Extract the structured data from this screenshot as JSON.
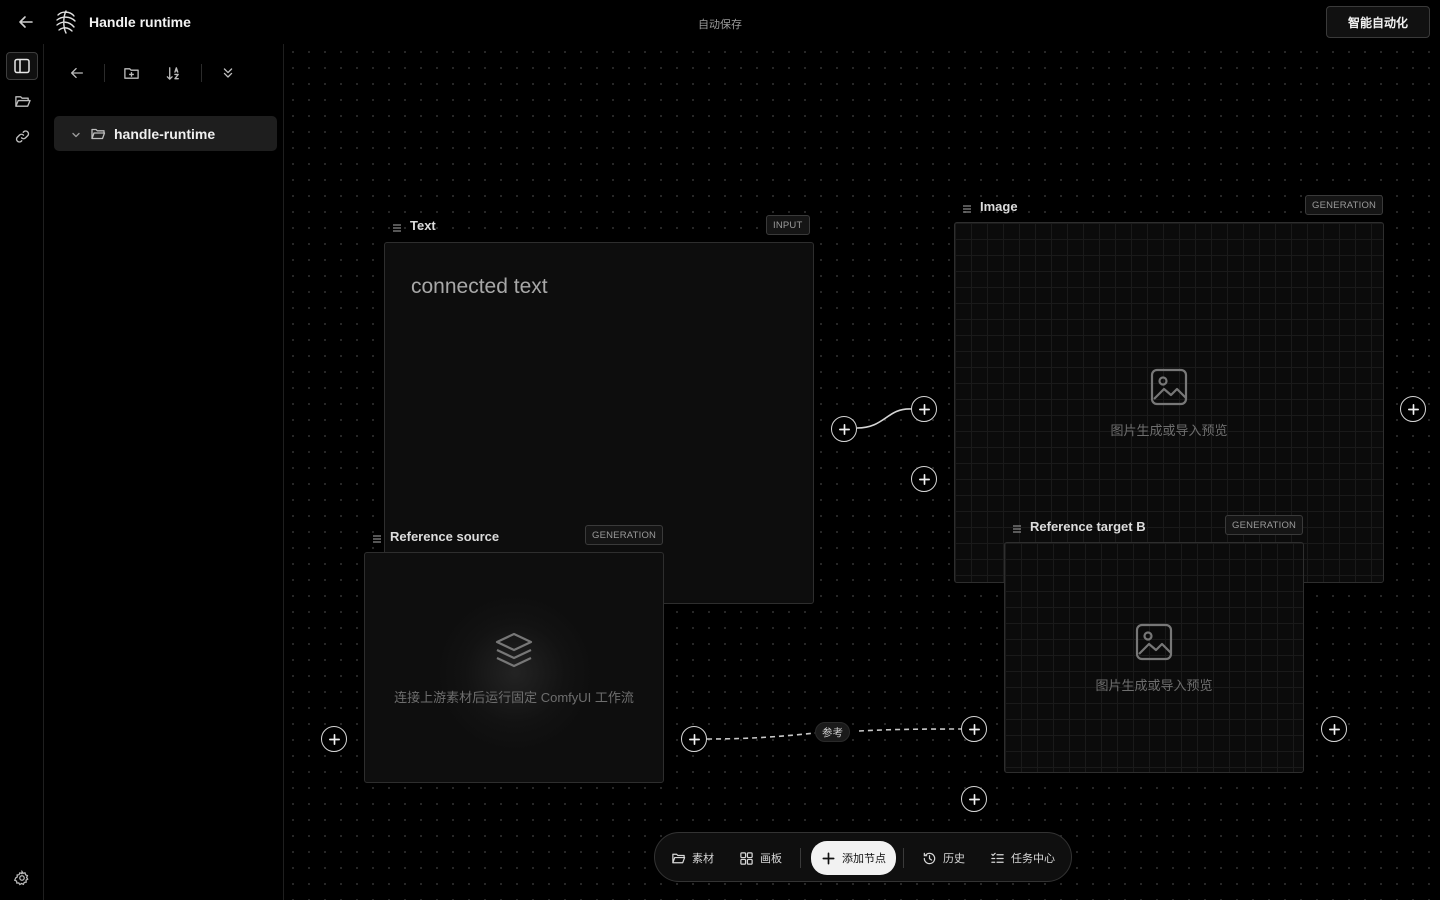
{
  "header": {
    "title": "Handle runtime",
    "autosave": "自动保存",
    "smart_button": "智能自动化"
  },
  "sidebar": {
    "tree": [
      {
        "label": "handle-runtime",
        "expanded": true
      }
    ]
  },
  "canvas": {
    "nodes": {
      "text": {
        "title": "Text",
        "badge": "INPUT",
        "content": "connected text"
      },
      "image": {
        "title": "Image",
        "badge": "GENERATION",
        "placeholder": "图片生成或导入预览"
      },
      "ref_source": {
        "title": "Reference source",
        "badge": "GENERATION",
        "placeholder": "连接上游素材后运行固定 ComfyUI 工作流"
      },
      "ref_target": {
        "title": "Reference target B",
        "badge": "GENERATION",
        "placeholder": "图片生成或导入预览"
      }
    },
    "edge_label": "参考"
  },
  "dock": {
    "assets": "素材",
    "boards": "画板",
    "add_node": "添加节点",
    "history": "历史",
    "tasks": "任务中心"
  }
}
